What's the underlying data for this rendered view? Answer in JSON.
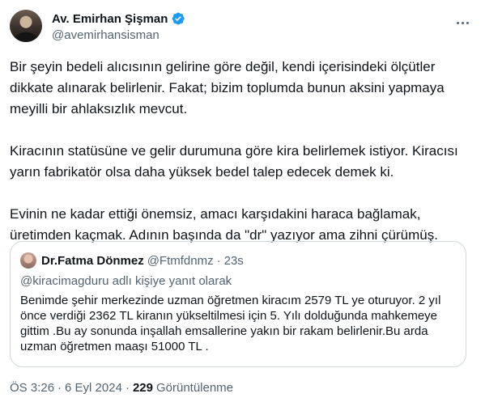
{
  "author": {
    "display_name": "Av. Emirhan Şişman",
    "handle": "@avemirhansisman",
    "verified_color": "#1d9bf0"
  },
  "tweet": {
    "paragraphs": [
      "Bir şeyin bedeli alıcısının gelirine göre değil, kendi içerisindeki ölçütler dikkate alınarak belirlenir. Fakat; bizim toplumda bunun aksini yapmaya meyilli bir ahlaksızlık mevcut.",
      "Kiracının statüsüne ve gelir durumuna göre kira belirlemek istiyor. Kiracısı yarın fabrikatör olsa daha yüksek bedel talep edecek demek ki.",
      "Evinin ne kadar ettiği önemsiz, amacı karşıdakini haraca bağlamak, üretimden kaçmak. Adının başında da \"dr\" yazıyor ama zihni çürümüş."
    ]
  },
  "quote": {
    "display_name": "Dr.Fatma Dönmez",
    "handle": "@Ftmfdnmz",
    "separator": "·",
    "time": "23s",
    "reply_context": "@kiracimagduru adlı kişiye yanıt olarak",
    "text": "Benimde şehir merkezinde uzman öğretmen kiracım 2579 TL ye oturuyor. 2 yıl\nönce  verdiği 2362 TL kiranın yükseltilmesi için 5. Yılı dolduğunda mahkemeye\ngittim .Bu ay sonunda inşallah emsallerine yakın  bir rakam belirlenir.Bu arda\nuzman öğretmen maaşı 51000 TL ."
  },
  "meta": {
    "time": "ÖS 3:26",
    "separator": "·",
    "date": "6 Eyl 2024",
    "views_count": "229",
    "views_label": "Görüntülenme"
  }
}
